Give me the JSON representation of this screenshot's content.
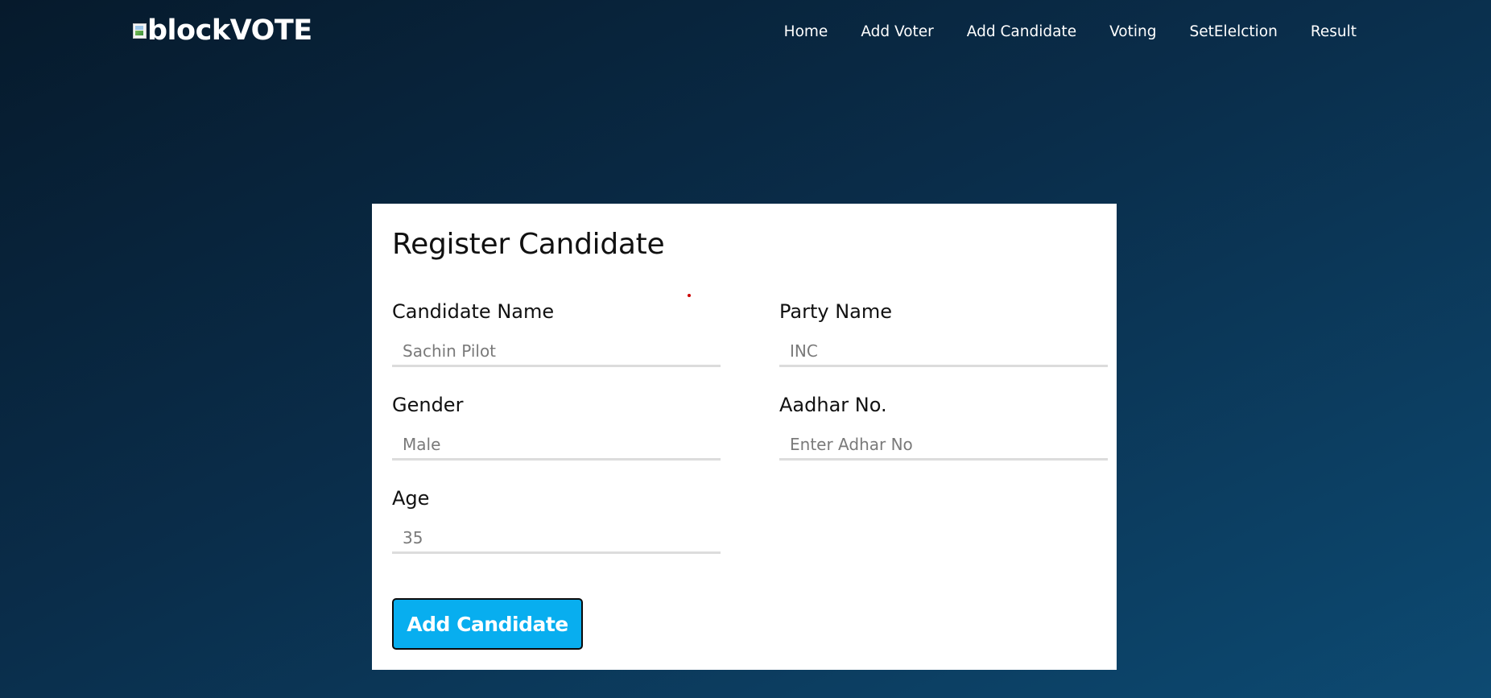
{
  "app": {
    "logo_text": "blockVOTE",
    "logo_icon": "broken-image-icon"
  },
  "nav": {
    "items": [
      {
        "label": "Home"
      },
      {
        "label": "Add Voter"
      },
      {
        "label": "Add Candidate"
      },
      {
        "label": "Voting"
      },
      {
        "label": "SetElelction"
      },
      {
        "label": "Result"
      }
    ]
  },
  "form": {
    "title": "Register Candidate",
    "fields": {
      "candidate_name": {
        "label": "Candidate Name",
        "placeholder": "Sachin Pilot",
        "value": ""
      },
      "party_name": {
        "label": "Party Name",
        "placeholder": "INC",
        "value": ""
      },
      "gender": {
        "label": "Gender",
        "placeholder": "Male",
        "value": ""
      },
      "aadhar": {
        "label": "Aadhar No.",
        "placeholder": "Enter Adhar No",
        "value": ""
      },
      "age": {
        "label": "Age",
        "placeholder": "35",
        "value": ""
      }
    },
    "submit_label": "Add Candidate"
  },
  "colors": {
    "background_dark": "#061a2c",
    "background_light": "#0d4a72",
    "button": "#08aeef",
    "card": "#ffffff"
  }
}
